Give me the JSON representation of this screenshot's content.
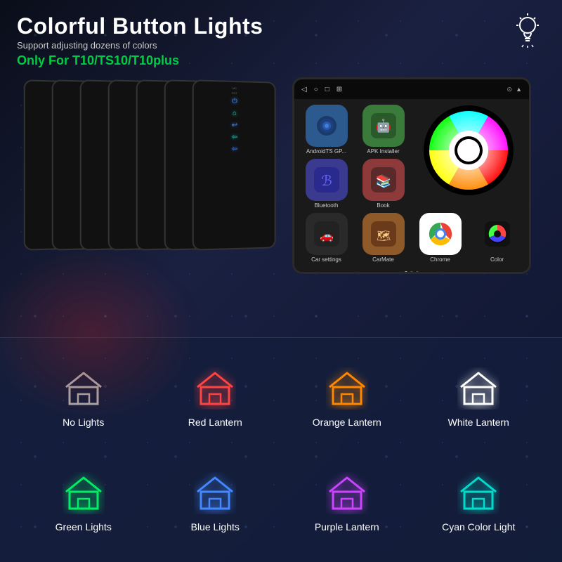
{
  "header": {
    "title": "Colorful Button Lights",
    "subtitle": "Support adjusting dozens of colors",
    "compatibility": "Only For T10/TS10/T10plus"
  },
  "screens": {
    "count": 7,
    "colors": [
      "purple",
      "red",
      "green",
      "blue",
      "orange",
      "white",
      "cyan"
    ]
  },
  "apps": [
    {
      "name": "AndroidTS GP...",
      "key": "androidts"
    },
    {
      "name": "APK Installer",
      "key": "apk"
    },
    {
      "name": "Bluetooth",
      "key": "bluetooth"
    },
    {
      "name": "Book",
      "key": "book"
    },
    {
      "name": "Car settings",
      "key": "carsettings"
    },
    {
      "name": "CarMate",
      "key": "carmate"
    },
    {
      "name": "Chrome",
      "key": "chrome"
    },
    {
      "name": "Color",
      "key": "color-app"
    }
  ],
  "lights": [
    {
      "id": "no-lights",
      "label": "No Lights",
      "color": "none"
    },
    {
      "id": "red-lantern",
      "label": "Red Lantern",
      "color": "red"
    },
    {
      "id": "orange-lantern",
      "label": "Orange Lantern",
      "color": "orange"
    },
    {
      "id": "white-lantern",
      "label": "White Lantern",
      "color": "white"
    },
    {
      "id": "green-lights",
      "label": "Green Lights",
      "color": "green"
    },
    {
      "id": "blue-lights",
      "label": "Blue Lights",
      "color": "blue"
    },
    {
      "id": "purple-lantern",
      "label": "Purple Lantern",
      "color": "purple"
    },
    {
      "id": "cyan-light",
      "label": "Cyan Color Light",
      "color": "cyan"
    }
  ]
}
